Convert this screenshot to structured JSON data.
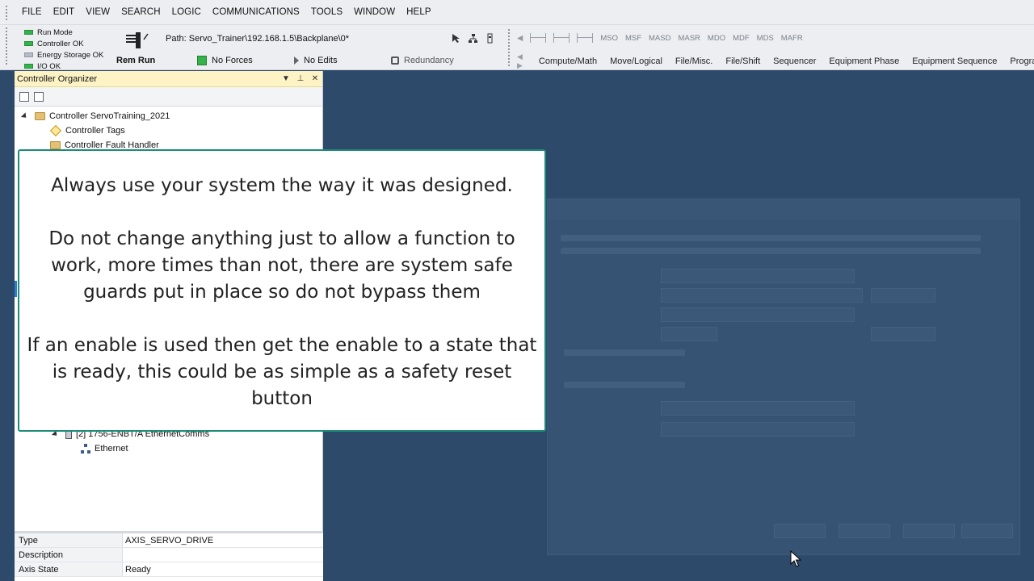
{
  "menu": [
    "FILE",
    "EDIT",
    "VIEW",
    "SEARCH",
    "LOGIC",
    "COMMUNICATIONS",
    "TOOLS",
    "WINDOW",
    "HELP"
  ],
  "status_leds": [
    {
      "label": "Run Mode",
      "on": true
    },
    {
      "label": "Controller OK",
      "on": true
    },
    {
      "label": "Energy Storage OK",
      "on": false
    },
    {
      "label": "I/O OK",
      "on": true
    }
  ],
  "toolbar": {
    "path": "Path: Servo_Trainer\\192.168.1.5\\Backplane\\0*",
    "rem_run": "Rem Run",
    "forces": "No Forces",
    "edits": "No Edits",
    "redundancy": "Redundancy",
    "instructions": [
      "MSO",
      "MSF",
      "MASD",
      "MASR",
      "MDO",
      "MDF",
      "MDS",
      "MAFR"
    ],
    "tabs": [
      "Compute/Math",
      "Move/Logical",
      "File/Misc.",
      "File/Shift",
      "Sequencer",
      "Equipment Phase",
      "Equipment Sequence",
      "Program"
    ]
  },
  "organizer": {
    "title": "Controller Organizer",
    "tree": {
      "controller": "Controller ServoTraining_2021",
      "tags": "Controller Tags",
      "fault_handler": "Controller Fault Handler",
      "module": "[2] 1756-ENBT/A EthernetComms",
      "ethernet": "Ethernet"
    },
    "properties": [
      {
        "key": "Type",
        "value": "AXIS_SERVO_DRIVE"
      },
      {
        "key": "Description",
        "value": ""
      },
      {
        "key": "Axis State",
        "value": "Ready"
      }
    ]
  },
  "overlay": {
    "line1": "Always use your system the way it was designed.",
    "line2": "Do not change anything just to allow a function to work, more times than not, there are system safe guards put in place so do not bypass them",
    "line3": "If an enable is used then get the enable to a state that is ready, this could be as simple as a safety reset button"
  }
}
